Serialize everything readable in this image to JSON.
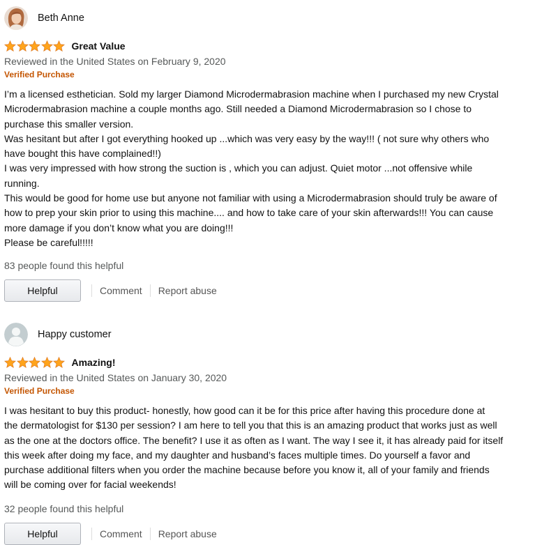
{
  "colors": {
    "star": "#ffa41c",
    "verified": "#c45500",
    "meta_text": "#565959"
  },
  "reviews": [
    {
      "author": "Beth Anne",
      "avatar": "profile-photo",
      "rating": 5,
      "title": "Great Value",
      "date_line": "Reviewed in the United States on February 9, 2020",
      "verified": "Verified Purchase",
      "lines": [
        "I’m a licensed esthetician. Sold my larger Diamond Microdermabrasion machine when I purchased my new Crystal",
        "Microdermabrasion machine a couple months ago. Still needed a Diamond Microdermabrasion so I chose to",
        "purchase this smaller version.",
        "Was hesitant but after I got everything hooked up ...which was very easy by the way!!! ( not sure why others who",
        "have bought this have complained!!)",
        "I was very impressed with how strong the suction is , which you can adjust. Quiet motor ...not offensive while",
        "running.",
        "This would be good for home use but anyone not familiar with using a Microdermabrasion should truly be aware of",
        "how to prep your skin prior to using this machine.... and how to take care of your skin afterwards!!! You can cause",
        "more damage if you don’t know what you are doing!!!",
        "Please be careful!!!!!"
      ],
      "helpful_count": "83 people found this helpful",
      "helpful_button": "Helpful",
      "comment_link": "Comment",
      "report_link": "Report abuse"
    },
    {
      "author": "Happy customer",
      "avatar": "default-user-icon",
      "rating": 5,
      "title": "Amazing!",
      "date_line": "Reviewed in the United States on January 30, 2020",
      "verified": "Verified Purchase",
      "lines": [
        "I was hesitant to buy this product- honestly, how good can it be for this price after having this procedure done at",
        "the dermatologist for $130 per session? I am here to tell you that this is an amazing product that works just as well",
        "as the one at the doctors office. The benefit? I use it as often as I want. The way I see it, it has already paid for itself",
        "this week after doing my face, and my daughter and husband’s faces multiple times. Do yourself a favor and",
        "purchase additional filters when you order the machine because before you know it, all of your family and friends",
        "will be coming over for facial weekends!"
      ],
      "helpful_count": "32 people found this helpful",
      "helpful_button": "Helpful",
      "comment_link": "Comment",
      "report_link": "Report abuse"
    }
  ]
}
